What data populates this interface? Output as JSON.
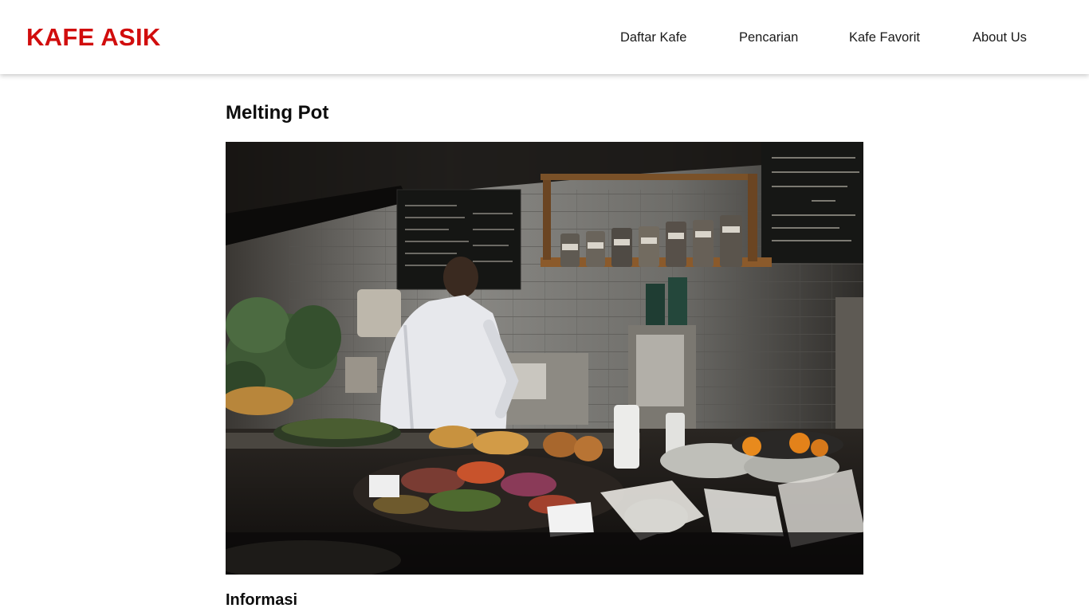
{
  "brand": {
    "name": "KAFE ASIK",
    "color": "#d10d0d"
  },
  "nav": {
    "items": [
      {
        "label": "Daftar Kafe"
      },
      {
        "label": "Pencarian"
      },
      {
        "label": "Kafe Favorit"
      },
      {
        "label": "About Us"
      }
    ]
  },
  "restaurant": {
    "name": "Melting Pot",
    "image_description": "cafe-counter-photo",
    "info_heading": "Informasi"
  }
}
